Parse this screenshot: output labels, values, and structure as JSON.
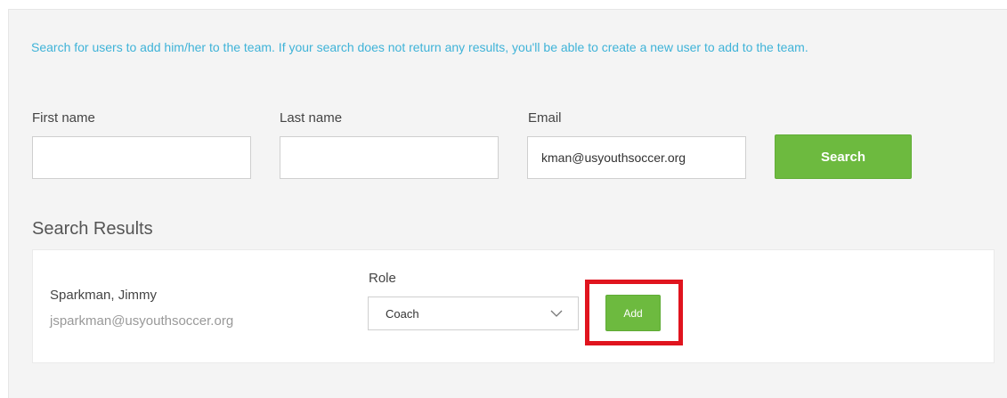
{
  "intro_text": "Search for users to add him/her to the team. If your search does not return any results, you'll be able to create a new user to add to the team.",
  "search_form": {
    "first_name": {
      "label": "First name",
      "value": ""
    },
    "last_name": {
      "label": "Last name",
      "value": ""
    },
    "email": {
      "label": "Email",
      "value": "kman@usyouthsoccer.org"
    },
    "search_label": "Search"
  },
  "results": {
    "heading": "Search Results",
    "items": [
      {
        "name": "Sparkman, Jimmy",
        "email": "jsparkman@usyouthsoccer.org",
        "role_label": "Role",
        "role_value": "Coach",
        "add_label": "Add"
      }
    ]
  },
  "colors": {
    "intro_text": "#3fb3d8",
    "button_green": "#6dba3f",
    "highlight_red": "#e0141e",
    "panel_bg": "#f4f4f4"
  },
  "icons": {
    "role_dropdown": "chevron-down-icon"
  }
}
